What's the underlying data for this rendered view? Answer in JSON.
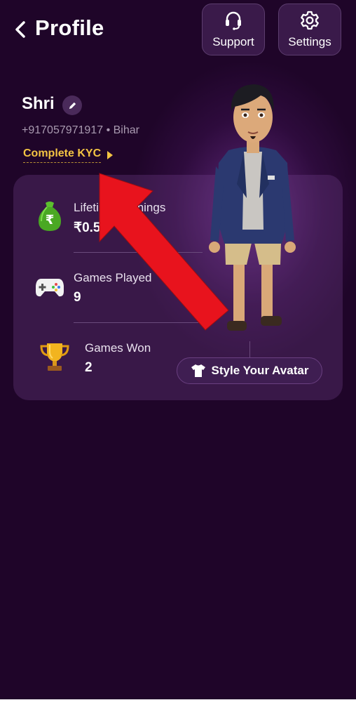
{
  "header": {
    "back_icon": "chevron-left-icon",
    "title": "Profile",
    "support_label": "Support",
    "settings_label": "Settings"
  },
  "profile": {
    "name": "Shri",
    "phone_location": "+917057971917 • Bihar",
    "kyc_label": "Complete KYC"
  },
  "stats": [
    {
      "label": "Lifetime Earnings",
      "value": "₹0.5",
      "icon": "money-bag-icon"
    },
    {
      "label": "Games Played",
      "value": "9",
      "icon": "gamepad-icon"
    },
    {
      "label": "Games Won",
      "value": "2",
      "icon": "trophy-icon"
    }
  ],
  "avatar": {
    "style_button_label": "Style Your Avatar",
    "style_button_icon": "tshirt-icon"
  },
  "colors": {
    "background": "#1f0529",
    "accent_yellow": "#f3c443",
    "annotation_arrow": "#e8131d"
  }
}
